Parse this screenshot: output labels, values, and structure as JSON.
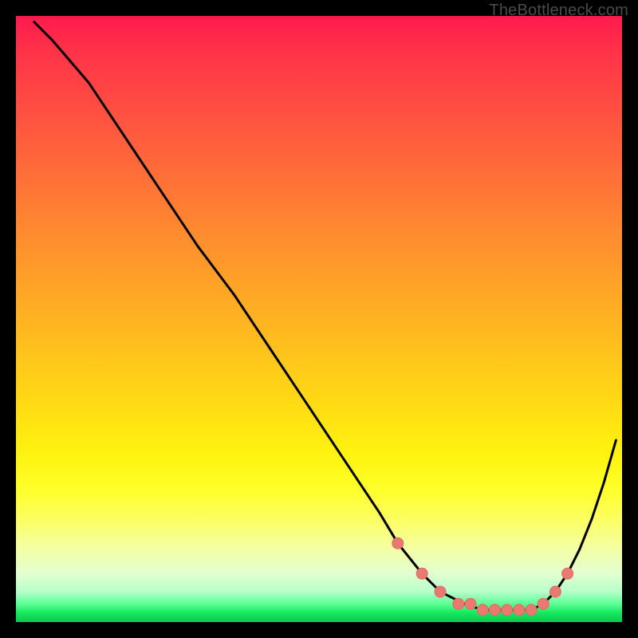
{
  "attribution": "TheBottleneck.com",
  "chart_data": {
    "type": "line",
    "title": "",
    "xlabel": "",
    "ylabel": "",
    "xlim": [
      0,
      100
    ],
    "ylim": [
      0,
      100
    ],
    "series": [
      {
        "name": "bottleneck-curve",
        "x": [
          3,
          6,
          12,
          18,
          24,
          30,
          36,
          42,
          48,
          54,
          60,
          63,
          67,
          70,
          74,
          77,
          80,
          83,
          85,
          87,
          89,
          91,
          93,
          95,
          97,
          99
        ],
        "y": [
          99,
          96,
          89,
          80,
          71,
          62,
          54,
          45,
          36,
          27,
          18,
          13,
          8,
          5,
          3,
          2,
          2,
          2,
          2,
          3,
          5,
          8,
          12,
          17,
          23,
          30
        ]
      }
    ],
    "markers": {
      "name": "optimal-dots",
      "x": [
        63,
        67,
        70,
        73,
        75,
        77,
        79,
        81,
        83,
        85,
        87,
        89,
        91
      ],
      "y": [
        13,
        8,
        5,
        3,
        3,
        2,
        2,
        2,
        2,
        2,
        3,
        5,
        8
      ]
    },
    "gradient_stops": [
      {
        "pos": 0,
        "color": "#ff1a4d"
      },
      {
        "pos": 0.5,
        "color": "#ffb321"
      },
      {
        "pos": 0.8,
        "color": "#ffff28"
      },
      {
        "pos": 0.95,
        "color": "#b5ffca"
      },
      {
        "pos": 1.0,
        "color": "#0cc94e"
      }
    ]
  }
}
